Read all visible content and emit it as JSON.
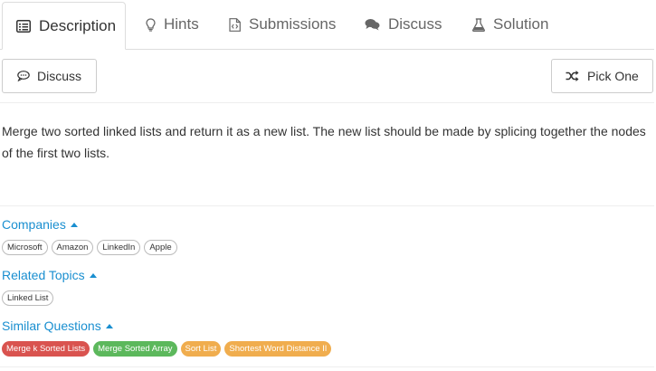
{
  "tabs": [
    {
      "label": "Description",
      "icon": "description-icon"
    },
    {
      "label": "Hints",
      "icon": "lightbulb-icon"
    },
    {
      "label": "Submissions",
      "icon": "code-file-icon"
    },
    {
      "label": "Discuss",
      "icon": "comments-icon"
    },
    {
      "label": "Solution",
      "icon": "flask-icon"
    }
  ],
  "toolbar": {
    "discuss_label": "Discuss",
    "pick_one_label": "Pick One"
  },
  "description": "Merge two sorted linked lists and return it as a new list. The new list should be made by splicing together the nodes of the first two lists.",
  "companies": {
    "title": "Companies",
    "tags": [
      "Microsoft",
      "Amazon",
      "LinkedIn",
      "Apple"
    ]
  },
  "related_topics": {
    "title": "Related Topics",
    "tags": [
      "Linked List"
    ]
  },
  "similar_questions": {
    "title": "Similar Questions",
    "items": [
      {
        "label": "Merge k Sorted Lists",
        "difficulty_color": "#d9534f"
      },
      {
        "label": "Merge Sorted Array",
        "difficulty_color": "#5cb85c"
      },
      {
        "label": "Sort List",
        "difficulty_color": "#f0ad4e"
      },
      {
        "label": "Shortest Word Distance II",
        "difficulty_color": "#f0ad4e"
      }
    ]
  },
  "colors": {
    "link": "#1a8fd0",
    "hard": "#d9534f",
    "easy": "#5cb85c",
    "medium": "#f0ad4e"
  }
}
